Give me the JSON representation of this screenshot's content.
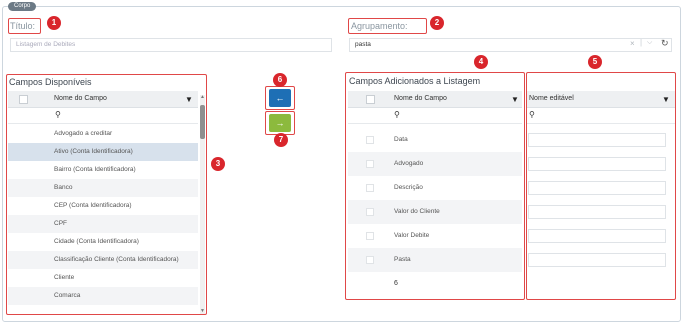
{
  "corpo_tab": "Corpo",
  "titulo": {
    "label": "Título:",
    "placeholder": "Listagem de Debites"
  },
  "agrupamento": {
    "label": "Agrupamento:",
    "value": "pasta"
  },
  "badges": [
    "1",
    "2",
    "3",
    "4",
    "5",
    "6",
    "7"
  ],
  "disponiveis": {
    "title": "Campos Disponíveis",
    "column": "Nome do Campo",
    "items": [
      "Advogado a creditar",
      "Ativo (Conta Identificadora)",
      "Bairro (Conta Identificadora)",
      "Banco",
      "CEP (Conta Identificadora)",
      "CPF",
      "Cidade (Conta Identificadora)",
      "Classificação Cliente (Conta Identificadora)",
      "Cliente",
      "Comarca"
    ]
  },
  "adicionados": {
    "title": "Campos Adicionados a Listagem",
    "column": "Nome do Campo",
    "items": [
      "Data",
      "Advogado",
      "Descrição",
      "Valor do Cliente",
      "Valor Debite",
      "Pasta"
    ],
    "count": "6"
  },
  "editavel": {
    "column": "Nome editável"
  },
  "buttons": {
    "remove_icon": "arrow-left-icon",
    "add_icon": "arrow-right-icon"
  },
  "colors": {
    "blue_btn": "#1e6fb5",
    "green_btn": "#8cba3d",
    "badge": "#d9262c",
    "highlight": "#e04848"
  }
}
